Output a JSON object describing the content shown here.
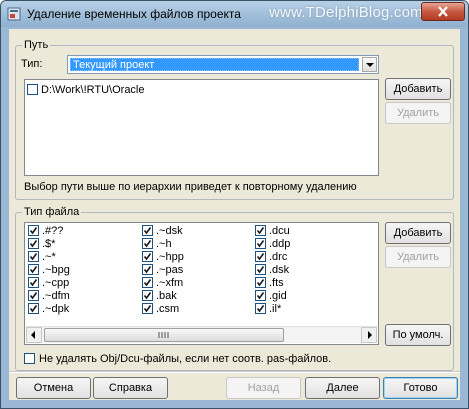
{
  "window": {
    "title": "Удаление временных файлов проекта",
    "watermark": "www.TDelphiBlog.com"
  },
  "path_group": {
    "label": "Путь",
    "type_label": "Тип:",
    "type_value": "Текущий проект",
    "items": [
      {
        "label": "D:\\Work\\!RTU\\Oracle",
        "checked": false
      }
    ],
    "add_button": "Добавить",
    "remove_button": "Удалить",
    "hint": "Выбор пути выше по иерархии приведет к повторному удалению"
  },
  "filetype_group": {
    "label": "Тип файла",
    "columns": [
      [
        ".#??",
        ".$*",
        ".~*",
        ".~bpg",
        ".~cpp",
        ".~dfm",
        ".~dpk"
      ],
      [
        ".~dsk",
        ".~h",
        ".~hpp",
        ".~pas",
        ".~xfm",
        ".bak",
        ".csm"
      ],
      [
        ".dcu",
        ".ddp",
        ".drc",
        ".dsk",
        ".fts",
        ".gid",
        ".il*"
      ]
    ],
    "all_checked": true,
    "add_button": "Добавить",
    "remove_button": "Удалить",
    "defaults_button": "По умолч."
  },
  "keep_obj_checkbox": {
    "label": "Не удалять Obj/Dcu-файлы, если нет соотв. pas-файлов.",
    "checked": false
  },
  "footer": {
    "cancel": "Отмена",
    "help": "Справка",
    "back": "Назад",
    "next": "Далее",
    "finish": "Готово"
  },
  "colors": {
    "selection": "#3399ff",
    "close_button": "#c75a42",
    "title_gradient_top": "#b7d0e6"
  }
}
